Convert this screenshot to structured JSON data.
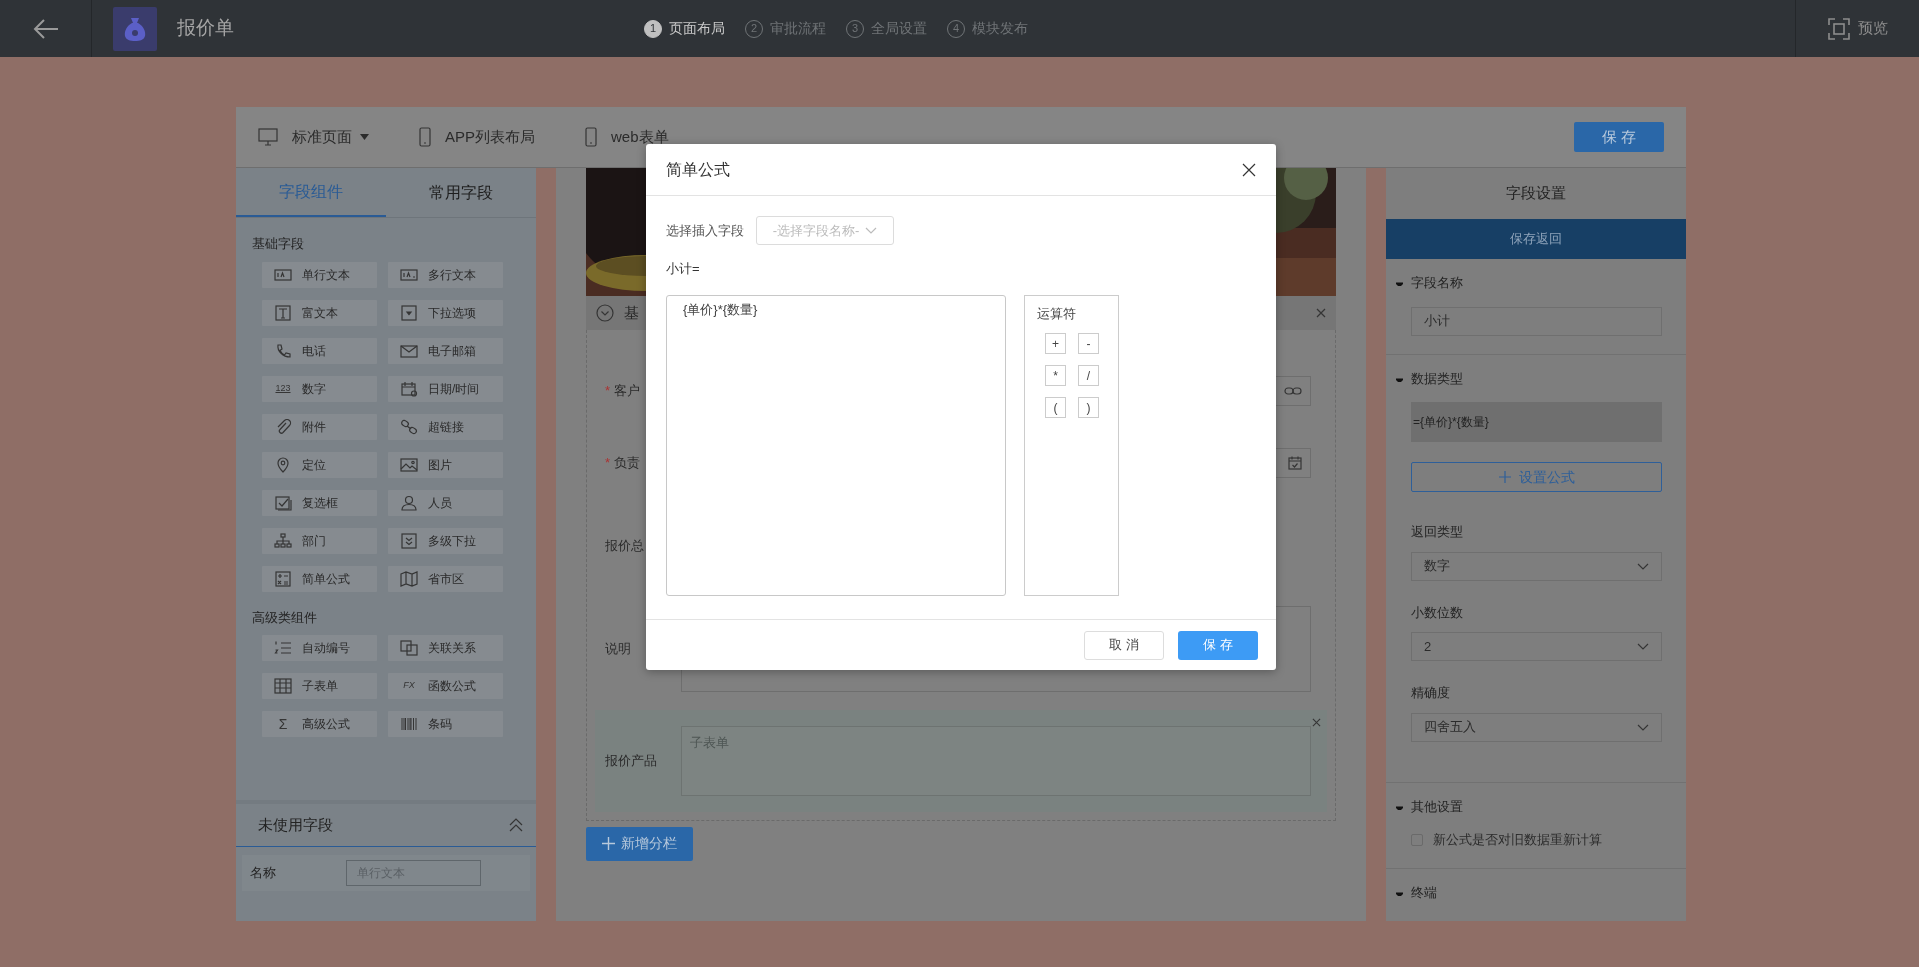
{
  "header": {
    "title": "报价单",
    "steps": [
      {
        "number": "1",
        "label": "页面布局",
        "selected": true
      },
      {
        "number": "2",
        "label": "审批流程",
        "selected": false
      },
      {
        "number": "3",
        "label": "全局设置",
        "selected": false
      },
      {
        "number": "4",
        "label": "模块发布",
        "selected": false
      }
    ],
    "preview": "预览"
  },
  "toolbar": {
    "views": [
      {
        "kind": "desktop",
        "label": "标准页面",
        "dropdown": true
      },
      {
        "kind": "phone",
        "label": "APP列表布局",
        "dropdown": false
      },
      {
        "kind": "phone",
        "label": "web表单",
        "dropdown": false
      }
    ],
    "save": "保 存"
  },
  "components": {
    "tabs": [
      {
        "label": "字段组件",
        "selected": true
      },
      {
        "label": "常用字段",
        "selected": false
      }
    ],
    "groups": [
      {
        "title": "基础字段",
        "items": [
          {
            "label": "单行文本"
          },
          {
            "label": "多行文本"
          },
          {
            "label": "富文本"
          },
          {
            "label": "下拉选项"
          },
          {
            "label": "电话"
          },
          {
            "label": "电子邮箱"
          },
          {
            "label": "数字",
            "icon_text": "123"
          },
          {
            "label": "日期/时间"
          },
          {
            "label": "附件"
          },
          {
            "label": "超链接"
          },
          {
            "label": "定位"
          },
          {
            "label": "图片"
          },
          {
            "label": "复选框"
          },
          {
            "label": "人员"
          },
          {
            "label": "部门"
          },
          {
            "label": "多级下拉"
          },
          {
            "label": "简单公式"
          },
          {
            "label": "省市区"
          }
        ]
      },
      {
        "title": "高级类组件",
        "items": [
          {
            "label": "自动编号"
          },
          {
            "label": "关联关系"
          },
          {
            "label": "子表单"
          },
          {
            "label": "函数公式",
            "icon_text": "FX"
          },
          {
            "label": "高级公式",
            "icon_text": "Σ"
          },
          {
            "label": "条码"
          }
        ]
      }
    ],
    "unused": {
      "title": "未使用字段",
      "expanded": true,
      "name_label": "名称",
      "name_placeholder": "单行文本"
    }
  },
  "form": {
    "section": "基",
    "fields": [
      {
        "kind": "link",
        "label": "客户",
        "required": true
      },
      {
        "kind": "date",
        "label": "负责",
        "required": true
      },
      {
        "kind": "plain",
        "label": "报价总",
        "required": false
      },
      {
        "kind": "textarea",
        "label": "说明",
        "required": false
      },
      {
        "kind": "subtable",
        "label": "报价产品",
        "required": false,
        "placeholder": "子表单"
      }
    ],
    "add_button": "新增分栏"
  },
  "modal": {
    "title": "简单公式",
    "insert_label": "选择插入字段",
    "insert_placeholder": "-选择字段名称-",
    "formula_label": "小计=",
    "formula": "{单价}*{数量}",
    "operators_title": "运算符",
    "operators": [
      "+",
      "-",
      "*",
      "/",
      "(",
      ")"
    ],
    "cancel": "取 消",
    "save": "保 存"
  },
  "settings": {
    "title": "字段设置",
    "save_return": "保存返回",
    "sections": [
      {
        "title": "字段名称",
        "items": [
          {
            "kind": "input",
            "value": "小计"
          }
        ]
      },
      {
        "title": "数据类型",
        "items": [
          {
            "kind": "formula",
            "value": "={单价}*{数量}"
          },
          {
            "kind": "button",
            "label": "设置公式"
          },
          {
            "kind": "select",
            "label": "返回类型",
            "value": "数字"
          },
          {
            "kind": "select",
            "label": "小数位数",
            "value": "2"
          },
          {
            "kind": "select",
            "label": "精确度",
            "value": "四舍五入"
          }
        ]
      },
      {
        "title": "其他设置",
        "items": [
          {
            "kind": "checkbox",
            "label": "新公式是否对旧数据重新计算",
            "checked": false
          }
        ]
      },
      {
        "title": "终端"
      }
    ]
  }
}
